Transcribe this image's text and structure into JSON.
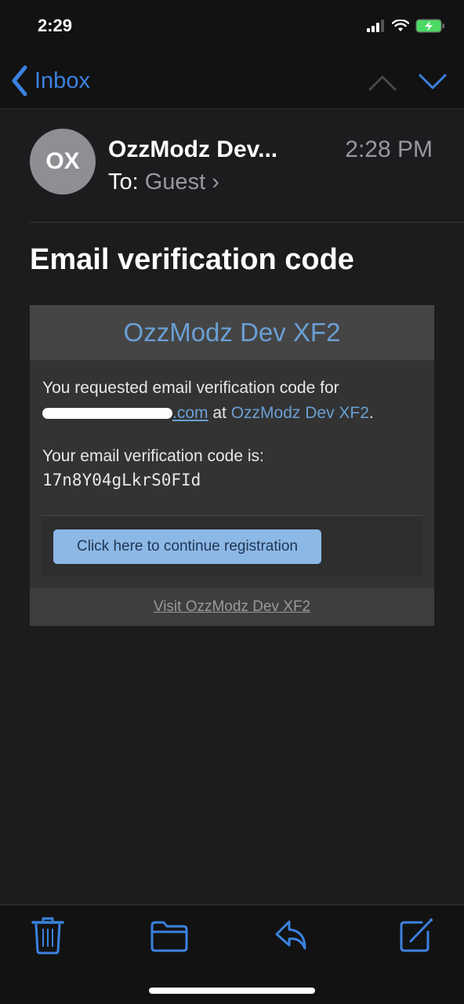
{
  "status_bar": {
    "time": "2:29",
    "icons": [
      "cellular-signal-icon",
      "wifi-icon",
      "battery-charging-icon"
    ],
    "battery_color": "#4cd964"
  },
  "nav": {
    "back_label": "Inbox",
    "back_icon": "chevron-left-icon",
    "prev_icon": "chevron-up-icon",
    "next_icon": "chevron-down-icon",
    "accent_color": "#3b82e0"
  },
  "message": {
    "avatar_initials": "OX",
    "sender": "OzzModz Dev...",
    "time": "2:28 PM",
    "to_label": "To:",
    "to_value": "Guest",
    "to_chevron": "›",
    "subject": "Email verification code"
  },
  "email": {
    "banner_title": "OzzModz Dev XF2",
    "intro_text": "You requested email verification code for",
    "email_suffix": ".com",
    "at_text": " at ",
    "site_link": "OzzModz Dev XF2",
    "period": ".",
    "code_label": "Your email verification code is:",
    "code": "17n8Y04gLkrS0FId",
    "cta_label": "Click here to continue registration",
    "footer_link": "Visit OzzModz Dev XF2",
    "link_color": "#6a9fd4",
    "button_color": "#8cb8e6"
  },
  "toolbar": {
    "items": [
      {
        "name": "trash-icon"
      },
      {
        "name": "folder-icon"
      },
      {
        "name": "reply-icon"
      },
      {
        "name": "compose-icon"
      }
    ]
  }
}
